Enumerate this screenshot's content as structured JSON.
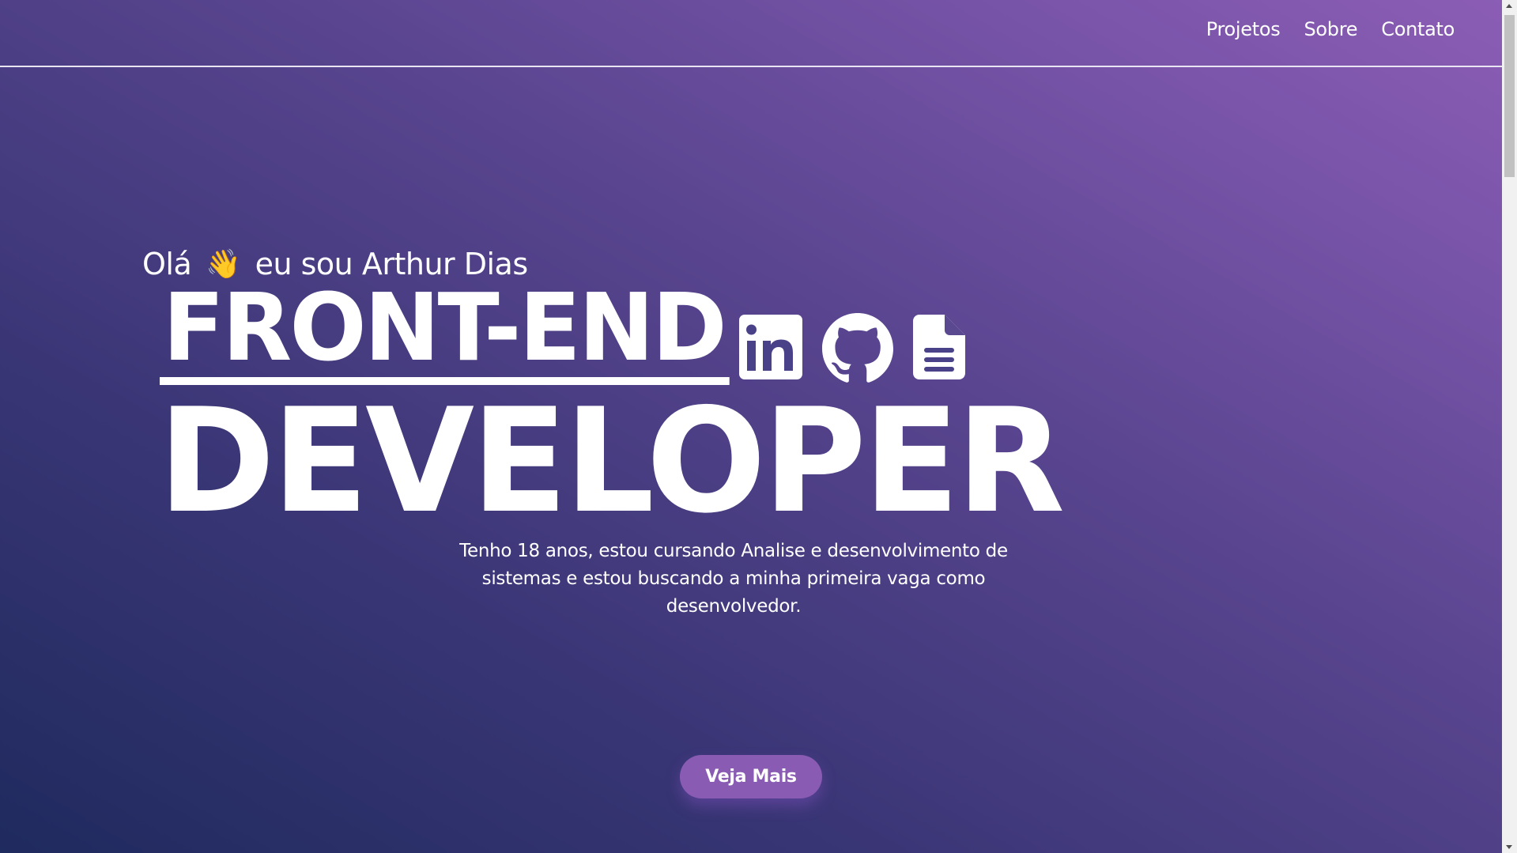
{
  "nav": {
    "items": [
      {
        "label": "Projetos"
      },
      {
        "label": "Sobre"
      },
      {
        "label": "Contato"
      }
    ]
  },
  "hero": {
    "greeting_before": "Olá",
    "wave_emoji": "👋",
    "greeting_after": "eu sou Arthur Dias",
    "title_line1": "FRONT-END",
    "title_line2": "DEVELOPER",
    "bio": "Tenho 18 anos, estou cursando Analise e desenvolvimento de sistemas e estou buscando a minha primeira vaga como desenvolvedor.",
    "cta_label": "Veja Mais"
  },
  "social": [
    {
      "icon": "linkedin-icon"
    },
    {
      "icon": "github-icon"
    },
    {
      "icon": "document-icon"
    }
  ],
  "colors": {
    "gradient_dark": "#1f2a5e",
    "gradient_light": "#8b5db4",
    "button": "#8a5bb3",
    "text": "#ffffff"
  }
}
